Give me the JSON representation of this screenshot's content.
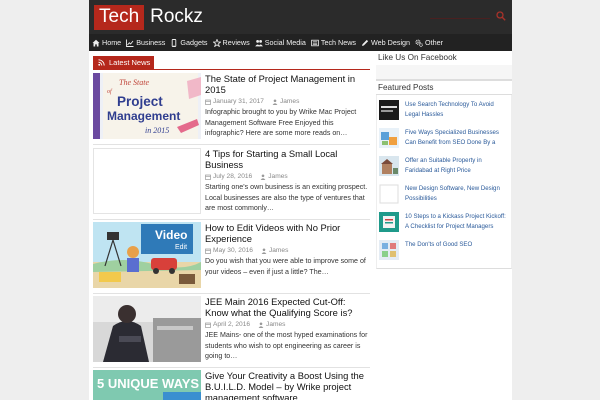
{
  "site": {
    "logo_primary": "Tech",
    "logo_secondary": "Rockz"
  },
  "nav": {
    "items": [
      {
        "label": "Home",
        "icon": "home-icon"
      },
      {
        "label": "Business",
        "icon": "chart-icon"
      },
      {
        "label": "Gadgets",
        "icon": "mobile-icon"
      },
      {
        "label": "Reviews",
        "icon": "star-icon"
      },
      {
        "label": "Social Media",
        "icon": "users-icon"
      },
      {
        "label": "Tech News",
        "icon": "newspaper-icon"
      },
      {
        "label": "Web Design",
        "icon": "pencil-icon"
      },
      {
        "label": "Other",
        "icon": "gears-icon"
      }
    ]
  },
  "latest": {
    "label": "Latest News",
    "posts": [
      {
        "title": "The State of Project Management in 2015",
        "date": "January 31, 2017",
        "author": "James",
        "excerpt": "Infographic brought to you by Wrike Mac Project Management Software Free Enjoyed this infographic? Here are some more reads on…",
        "thumb_text": [
          "The State",
          "of",
          "Project",
          "Management",
          "in 2015"
        ]
      },
      {
        "title": "4 Tips for Starting a Small Local Business",
        "date": "July 28, 2016",
        "author": "James",
        "excerpt": "Starting one's own business is an exciting prospect. Local businesses are also the type of ventures that are most commonly…"
      },
      {
        "title": "How to Edit Videos with No Prior Experience",
        "date": "May 30, 2016",
        "author": "James",
        "excerpt": "Do you wish that you were able to improve some of your videos – even if just a little? The…",
        "thumb_text": [
          "Video",
          "Edit"
        ]
      },
      {
        "title": "JEE Main 2016 Expected Cut-Off: Know what the Qualifying Score is?",
        "date": "April 2, 2016",
        "author": "James",
        "excerpt": "JEE Mains- one of the most hyped examinations for students who wish to opt engineering as career is going to…"
      },
      {
        "title": "Give Your Creativity a Boost Using the B.U.I.L.D. Model – by Wrike project management software",
        "thumb_text": [
          "5 UNIQUE WAYS"
        ]
      }
    ]
  },
  "sidebar": {
    "like_title": "Like Us On Facebook",
    "featured_title": "Featured Posts",
    "featured": [
      {
        "title": "Use Search Technology To Avoid Legal Hassles"
      },
      {
        "title": "Five Ways Specialized Businesses Can Benefit from SEO Done By a"
      },
      {
        "title": "Offer an Suitable Property in Faridabad at Right Price"
      },
      {
        "title": "New Design Software, New Design Possibilities"
      },
      {
        "title": "10 Steps to a Kickass Project Kickoff: A Checklist for Project Managers"
      },
      {
        "title": "The Don'ts of Good SEO"
      }
    ]
  },
  "colors": {
    "accent": "#b5281c",
    "header_bg": "#2b2b2b",
    "nav_bg": "#222222",
    "link": "#2a5a9a"
  }
}
